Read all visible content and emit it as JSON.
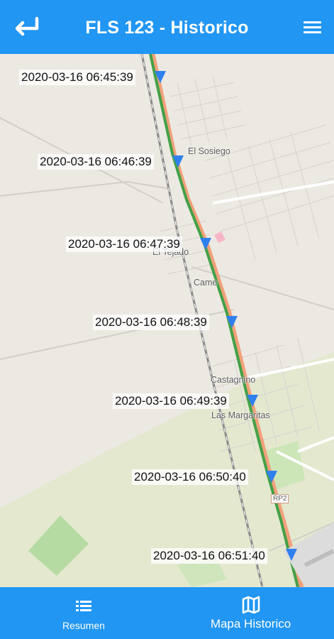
{
  "header": {
    "title": "FLS 123 - Historico",
    "back_icon": "arrow-return-icon",
    "menu_icon": "hamburger-menu-icon",
    "color": "#2196f3"
  },
  "map": {
    "route_color": "#43a047",
    "road_color": "#f2a07a",
    "marker_color": "#2f80ed",
    "places": [
      "El Sosiego",
      "El Tejado",
      "Came",
      "Castagnino",
      "Las Margaritas",
      "RP2"
    ],
    "timestamps": [
      "2020-03-16 06:45:39",
      "2020-03-16 06:46:39",
      "2020-03-16 06:47:39",
      "2020-03-16 06:48:39",
      "2020-03-16 06:49:39",
      "2020-03-16 06:50:40",
      "2020-03-16 06:51:40"
    ]
  },
  "bottom_nav": {
    "tabs": [
      {
        "label": "Resumen",
        "icon": "list-icon"
      },
      {
        "label": "Mapa Historico",
        "icon": "map-icon"
      }
    ]
  }
}
